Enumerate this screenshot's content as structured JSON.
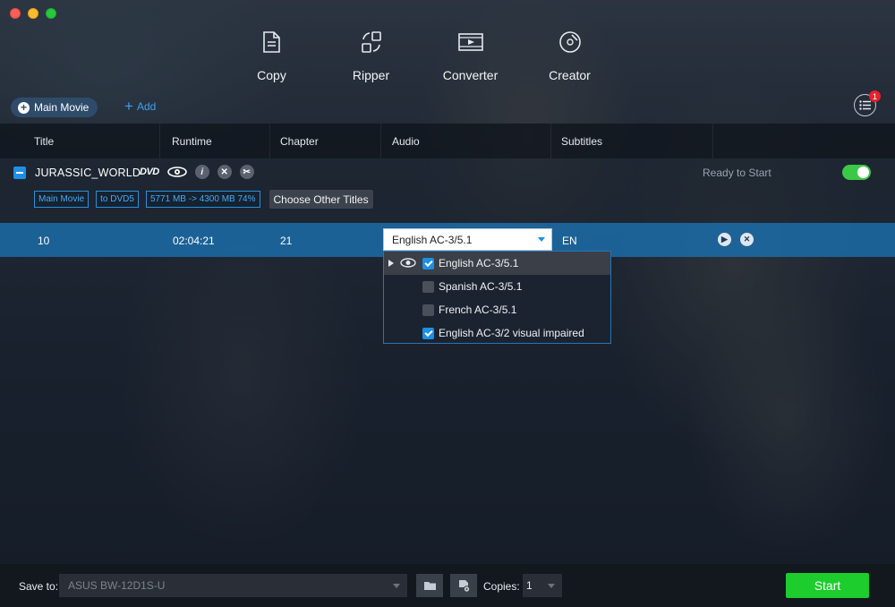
{
  "window": {
    "controls": [
      "close",
      "minimize",
      "maximize"
    ]
  },
  "tools": [
    {
      "label": "Copy",
      "icon": "copy-doc-icon"
    },
    {
      "label": "Ripper",
      "icon": "ripper-icon"
    },
    {
      "label": "Converter",
      "icon": "film-play-icon"
    },
    {
      "label": "Creator",
      "icon": "disc-icon"
    }
  ],
  "toolbar": {
    "main_movie_label": "Main Movie",
    "add_label": "Add",
    "queue_badge": "1"
  },
  "table": {
    "headers": [
      "Title",
      "Runtime",
      "Chapter",
      "Audio",
      "Subtitles"
    ]
  },
  "title_entry": {
    "name": "JURASSIC_WORLD",
    "dvd_logo": "DVD",
    "info_glyph": "i",
    "status": "Ready to Start",
    "enabled": true,
    "tags": [
      "Main Movie",
      "to DVD5",
      "5771 MB -> 4300 MB 74%"
    ],
    "choose_button": "Choose Other Titles"
  },
  "selected_row": {
    "title": "10",
    "runtime": "02:04:21",
    "chapter": "21",
    "audio": "English AC-3/5.1",
    "subtitles": "EN"
  },
  "audio_options": [
    {
      "label": "English AC-3/5.1",
      "checked": true,
      "active": true
    },
    {
      "label": "Spanish AC-3/5.1",
      "checked": false,
      "active": false
    },
    {
      "label": "French AC-3/5.1",
      "checked": false,
      "active": false
    },
    {
      "label": "English AC-3/2 visual impaired",
      "checked": true,
      "active": false
    }
  ],
  "bottom": {
    "save_to_label": "Save to:",
    "save_to_value": "ASUS BW-12D1S-U",
    "copies_label": "Copies:",
    "copies_value": "1",
    "start_label": "Start"
  },
  "colors": {
    "accent": "#1c8fe6",
    "start": "#1ccd2d",
    "toggle_on": "#3ac846",
    "badge": "#e3232d",
    "selected_row": "#1c6ca8"
  }
}
